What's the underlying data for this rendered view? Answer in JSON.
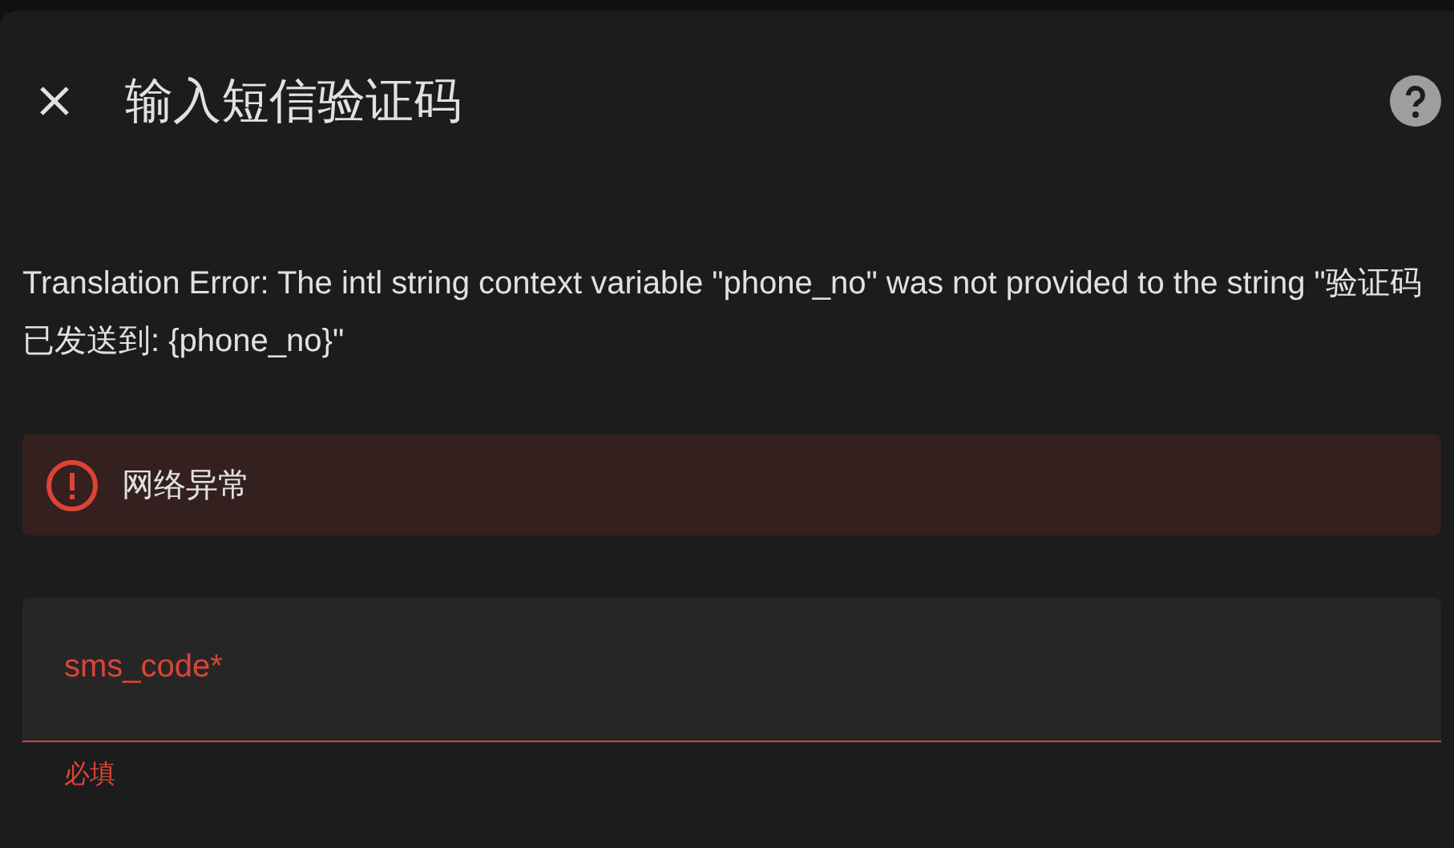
{
  "dialog": {
    "title": "输入短信验证码"
  },
  "description": "Translation Error: The intl string context variable \"phone_no\" was not provided to the string \"验证码已发送到: {phone_no}\"",
  "alert": {
    "kind": "error",
    "message": "网络异常"
  },
  "field": {
    "label": "sms_code*",
    "invalid": true,
    "helper": "必填"
  }
}
